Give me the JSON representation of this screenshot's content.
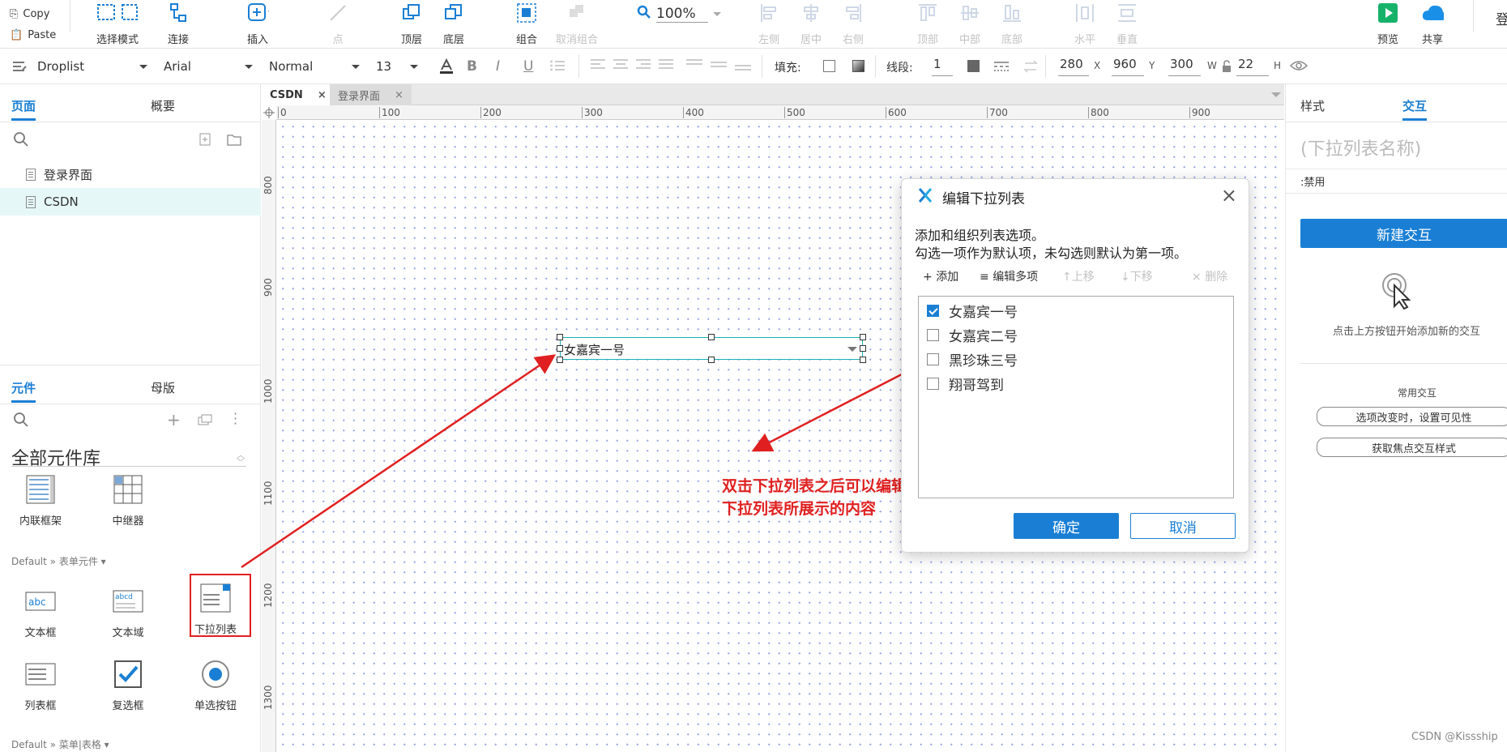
{
  "clipboard": {
    "copy": "Copy",
    "paste": "Paste"
  },
  "toolbar1": {
    "select_mode": "选择模式",
    "connect": "连接",
    "insert": "插入",
    "point": "点",
    "top_layer": "顶层",
    "bottom_layer": "底层",
    "group": "组合",
    "ungroup": "取消组合",
    "zoom": "100%",
    "align_left": "左侧",
    "align_center": "居中",
    "align_right": "右侧",
    "align_top": "顶部",
    "align_middle": "中部",
    "align_bottom": "底部",
    "dist_h": "水平",
    "dist_v": "垂直",
    "preview": "预览",
    "share": "共享",
    "login": "登"
  },
  "toolbar2": {
    "widget_type": "Droplist",
    "font": "Arial",
    "style": "Normal",
    "size": "13",
    "fill_label": "填充:",
    "stroke_label": "线段:",
    "stroke_value": "1",
    "x": "280",
    "x_label": "X",
    "y": "960",
    "y_label": "Y",
    "w": "300",
    "w_label": "W",
    "h": "22",
    "h_label": "H"
  },
  "left_panel": {
    "tabs": [
      "页面",
      "概要"
    ],
    "pages": [
      "登录界面",
      "CSDN"
    ],
    "lib_tabs": [
      "元件",
      "母版"
    ],
    "library_title": "全部元件库",
    "components_top": [
      "内联框架",
      "中继器"
    ],
    "section_form": "Default » 表单元件 ▾",
    "components_form": [
      "文本框",
      "文本域",
      "下拉列表",
      "列表框",
      "复选框",
      "单选按钮"
    ],
    "section_menu": "Default » 菜单|表格 ▾"
  },
  "canvas": {
    "tabs": [
      "CSDN",
      "登录界面"
    ],
    "ruler_h": [
      "0",
      "100",
      "200",
      "300",
      "400",
      "500",
      "600",
      "700",
      "800",
      "900"
    ],
    "ruler_v": [
      "800",
      "900",
      "1000",
      "1100",
      "1200",
      "1300"
    ],
    "droplist_text": "女嘉宾一号",
    "annotation_line1": "双击下拉列表之后可以编辑",
    "annotation_line2": "下拉列表所展示的内容"
  },
  "dialog": {
    "title": "编辑下拉列表",
    "desc1": "添加和组织列表选项。",
    "desc2": "勾选一项作为默认项，未勾选则默认为第一项。",
    "actions": {
      "add": "添加",
      "edit_multi": "编辑多项",
      "up": "上移",
      "down": "下移",
      "delete": "删除"
    },
    "options": [
      {
        "label": "女嘉宾一号",
        "checked": true
      },
      {
        "label": "女嘉宾二号",
        "checked": false
      },
      {
        "label": "黑珍珠三号",
        "checked": false
      },
      {
        "label": "翔哥驾到",
        "checked": false
      }
    ],
    "ok": "确定",
    "cancel": "取消"
  },
  "right_panel": {
    "tabs": [
      "样式",
      "交互"
    ],
    "name_placeholder": "(下拉列表名称)",
    "disabled": ":禁用",
    "new_interaction": "新建交互",
    "hint": "点击上方按钮开始添加新的交互",
    "common": "常用交互",
    "common_items": [
      "选项改变时，设置可见性",
      "获取焦点交互样式"
    ]
  },
  "watermark": "CSDN @Kissship",
  "colors": {
    "accent": "#1a7fd4",
    "annotation": "#e02020",
    "selection": "#1ab0b8"
  }
}
